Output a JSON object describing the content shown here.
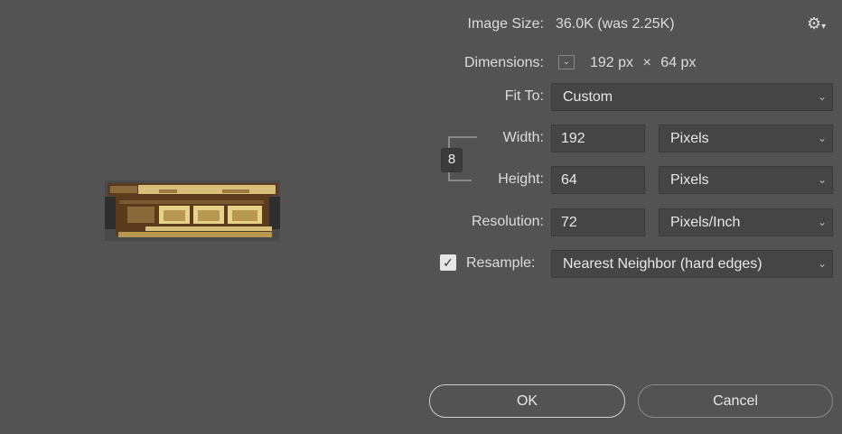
{
  "image_size": {
    "label": "Image Size:",
    "value": "36.0K (was 2.25K)"
  },
  "dimensions": {
    "label": "Dimensions:",
    "width": "192 px",
    "times": "×",
    "height": "64 px"
  },
  "fit_to": {
    "label": "Fit To:",
    "value": "Custom"
  },
  "width": {
    "label": "Width:",
    "value": "192",
    "unit": "Pixels"
  },
  "height": {
    "label": "Height:",
    "value": "64",
    "unit": "Pixels"
  },
  "resolution": {
    "label": "Resolution:",
    "value": "72",
    "unit": "Pixels/Inch"
  },
  "resample": {
    "label": "Resample:",
    "checked": true,
    "value": "Nearest Neighbor (hard edges)"
  },
  "buttons": {
    "ok": "OK",
    "cancel": "Cancel"
  },
  "icons": {
    "gear": "gear-icon",
    "link": "chain-link-icon",
    "chevron": "chevron-down-icon"
  }
}
